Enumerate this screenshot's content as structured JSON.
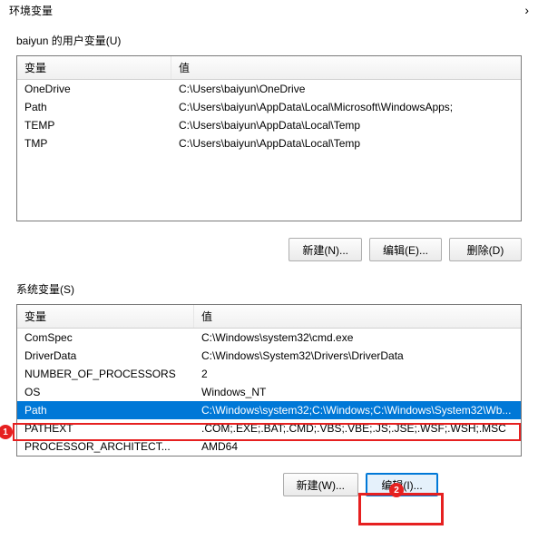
{
  "title_bar": {
    "title": "环境变量",
    "close": "›"
  },
  "user_section": {
    "label": "baiyun 的用户变量(U)",
    "headers": {
      "variable": "变量",
      "value": "值"
    },
    "rows": [
      {
        "variable": "OneDrive",
        "value": "C:\\Users\\baiyun\\OneDrive"
      },
      {
        "variable": "Path",
        "value": "C:\\Users\\baiyun\\AppData\\Local\\Microsoft\\WindowsApps;"
      },
      {
        "variable": "TEMP",
        "value": "C:\\Users\\baiyun\\AppData\\Local\\Temp"
      },
      {
        "variable": "TMP",
        "value": "C:\\Users\\baiyun\\AppData\\Local\\Temp"
      }
    ],
    "buttons": {
      "new": "新建(N)...",
      "edit": "编辑(E)...",
      "delete": "删除(D)"
    }
  },
  "system_section": {
    "label": "系统变量(S)",
    "headers": {
      "variable": "变量",
      "value": "值"
    },
    "rows": [
      {
        "variable": "ComSpec",
        "value": "C:\\Windows\\system32\\cmd.exe"
      },
      {
        "variable": "DriverData",
        "value": "C:\\Windows\\System32\\Drivers\\DriverData"
      },
      {
        "variable": "NUMBER_OF_PROCESSORS",
        "value": "2"
      },
      {
        "variable": "OS",
        "value": "Windows_NT"
      },
      {
        "variable": "Path",
        "value": "C:\\Windows\\system32;C:\\Windows;C:\\Windows\\System32\\Wb...",
        "selected": true
      },
      {
        "variable": "PATHEXT",
        "value": ".COM;.EXE;.BAT;.CMD;.VBS;.VBE;.JS;.JSE;.WSF;.WSH;.MSC"
      },
      {
        "variable": "PROCESSOR_ARCHITECT...",
        "value": "AMD64"
      }
    ],
    "buttons": {
      "new": "新建(W)...",
      "edit": "编辑(I)..."
    }
  },
  "markers": {
    "one": "1",
    "two": "2"
  }
}
